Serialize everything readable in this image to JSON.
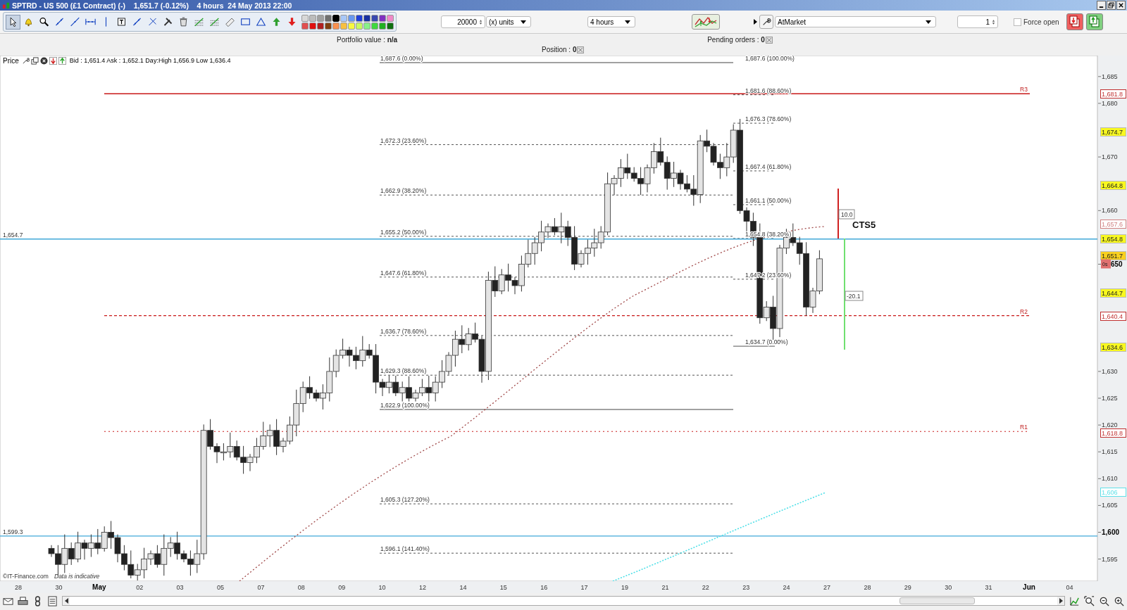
{
  "window": {
    "title": "SPTRD - US 500 (£1 Contract) (-)    1,651.7 (-0.12%)    4 hours  24 May 2013 22:00"
  },
  "toolbar": {
    "tools": [
      {
        "kind": "pointer",
        "selected": true
      },
      {
        "kind": "alert",
        "selected": false
      },
      {
        "kind": "zoom",
        "selected": false
      },
      {
        "kind": "segment",
        "selected": false
      },
      {
        "kind": "ray",
        "selected": false
      },
      {
        "kind": "hline",
        "selected": false
      },
      {
        "kind": "vline",
        "selected": false
      },
      {
        "kind": "text",
        "selected": false
      },
      {
        "kind": "segment",
        "selected": false
      },
      {
        "kind": "cross",
        "selected": false
      },
      {
        "kind": "hammer",
        "selected": false
      },
      {
        "kind": "delete",
        "selected": false
      },
      {
        "kind": "grid",
        "selected": false
      },
      {
        "kind": "grid",
        "selected": false
      },
      {
        "kind": "ruler",
        "selected": false
      },
      {
        "kind": "rectangle",
        "selected": false
      },
      {
        "kind": "triangle",
        "selected": false
      },
      {
        "kind": "up",
        "selected": false
      },
      {
        "kind": "down",
        "selected": false
      }
    ],
    "swatches": [
      {
        "color": "#d8d8d8",
        "selected": false
      },
      {
        "color": "#bcbcbc",
        "selected": false
      },
      {
        "color": "#a0a0a0",
        "selected": false
      },
      {
        "color": "#707070",
        "selected": false
      },
      {
        "color": "#000000",
        "selected": true
      },
      {
        "color": "#a8c8f8",
        "selected": false
      },
      {
        "color": "#6898f0",
        "selected": false
      },
      {
        "color": "#2040d8",
        "selected": false
      },
      {
        "color": "#1830a0",
        "selected": false
      },
      {
        "color": "#3848b0",
        "selected": false
      },
      {
        "color": "#8030c0",
        "selected": false
      },
      {
        "color": "#f088c8",
        "selected": false
      },
      {
        "color": "#e05050",
        "selected": false
      },
      {
        "color": "#e01010",
        "selected": false
      },
      {
        "color": "#b02020",
        "selected": false
      },
      {
        "color": "#804010",
        "selected": false
      },
      {
        "color": "#f89050",
        "selected": false
      },
      {
        "color": "#f8c040",
        "selected": false
      },
      {
        "color": "#f8f840",
        "selected": false
      },
      {
        "color": "#c8f860",
        "selected": false
      },
      {
        "color": "#88f088",
        "selected": false
      },
      {
        "color": "#40d840",
        "selected": false
      },
      {
        "color": "#20b020",
        "selected": false
      },
      {
        "color": "#107010",
        "selected": false
      }
    ],
    "quantity": "20000",
    "units": "(x) units",
    "interval": "4 hours",
    "order_type": "AtMarket",
    "lots": "1",
    "force_open": {
      "label": "Force open",
      "checked": false
    }
  },
  "info": {
    "portfolio": "Portfolio value : **n/a**",
    "position": "Position : **0**",
    "pending": "Pending orders : **0**"
  },
  "legend": {
    "title": "Price",
    "quote": "Bid : 1,651.4 Ask : 1,652.1 Day:High 1,656.9 Low 1,636.4"
  },
  "fib_left": [
    "1,687.6 (0.00%)",
    "1,672.3 (23.60%)",
    "1,662.9 (38.20%)",
    "1,655.2 (50.00%)",
    "1,647.6 (61.80%)",
    "1,636.7 (78.60%)",
    "1,629.3 (88.60%)",
    "1,622.9 (100.00%)",
    "1,605.3 (127.20%)",
    "1,596.1 (141.40%)"
  ],
  "fib_right": [
    "1,687.6 (100.00%)",
    "1,681.6 (88.60%)",
    "1,676.3 (78.60%)",
    "1,667.4 (61.80%)",
    "1,661.1 (50.00%)",
    "1,654.8 (38.20%)",
    "1,647.2 (23.60%)",
    "1,634.7 (0.00%)"
  ],
  "levels": [
    {
      "label": "R3",
      "kind": "solid"
    },
    {
      "label": "R2",
      "kind": "dashed"
    },
    {
      "label": "R1",
      "kind": "dotted"
    }
  ],
  "hlines": [
    "1,654.7",
    "1,599.3"
  ],
  "target": {
    "up": "10.0",
    "down": "-20.1",
    "name": "CTS5"
  },
  "price_ticks": [
    {
      "text": "1,685",
      "bold": false
    },
    {
      "text": "1,680",
      "bold": false
    },
    {
      "text": "1,670",
      "bold": false
    },
    {
      "text": "1,660",
      "bold": false
    },
    {
      "text": "650",
      "bold": true
    },
    {
      "text": "1,630",
      "bold": false
    },
    {
      "text": "1,625",
      "bold": false
    },
    {
      "text": "1,620",
      "bold": false
    },
    {
      "text": "1,615",
      "bold": false
    },
    {
      "text": "1,610",
      "bold": false
    },
    {
      "text": "1,605",
      "bold": false
    },
    {
      "text": "1,600",
      "bold": true
    },
    {
      "text": "1,595",
      "bold": false
    }
  ],
  "price_markers": [
    {
      "text": "1,681.8",
      "kind": "outlined",
      "color": "#c03030"
    },
    {
      "text": "1,674.7",
      "kind": "filled",
      "color": "#f8f820"
    },
    {
      "text": "1,664.8",
      "kind": "filled",
      "color": "#f8f820"
    },
    {
      "text": "1,657.6",
      "kind": "outlined",
      "color": "#d08080"
    },
    {
      "text": "1,654.8",
      "kind": "filled",
      "color": "#f8f820"
    },
    {
      "text": "1,651.7",
      "kind": "filled",
      "color": "#f8d020"
    },
    {
      "text": "1,644.7",
      "kind": "filled",
      "color": "#f8f820"
    },
    {
      "text": "1,640.4",
      "kind": "outlined",
      "color": "#c03030"
    },
    {
      "text": "1,634.6",
      "kind": "filled",
      "color": "#f8f820"
    },
    {
      "text": "1,618.8",
      "kind": "outlined",
      "color": "#c03030"
    },
    {
      "text": "1,606",
      "kind": "outlined",
      "color": "#60e0e8"
    }
  ],
  "countdown": "0s",
  "dates": [
    {
      "text": "28",
      "bold": false
    },
    {
      "text": "30",
      "bold": false
    },
    {
      "text": "May",
      "bold": true
    },
    {
      "text": "02",
      "bold": false
    },
    {
      "text": "03",
      "bold": false
    },
    {
      "text": "05",
      "bold": false
    },
    {
      "text": "07",
      "bold": false
    },
    {
      "text": "08",
      "bold": false
    },
    {
      "text": "09",
      "bold": false
    },
    {
      "text": "10",
      "bold": false
    },
    {
      "text": "12",
      "bold": false
    },
    {
      "text": "14",
      "bold": false
    },
    {
      "text": "15",
      "bold": false
    },
    {
      "text": "16",
      "bold": false
    },
    {
      "text": "17",
      "bold": false
    },
    {
      "text": "19",
      "bold": false
    },
    {
      "text": "21",
      "bold": false
    },
    {
      "text": "22",
      "bold": false
    },
    {
      "text": "23",
      "bold": false
    },
    {
      "text": "24",
      "bold": false
    },
    {
      "text": "27",
      "bold": false
    },
    {
      "text": "28",
      "bold": false
    },
    {
      "text": "29",
      "bold": false
    },
    {
      "text": "30",
      "bold": false
    },
    {
      "text": "31",
      "bold": false
    },
    {
      "text": "Jun",
      "bold": true
    },
    {
      "text": "04",
      "bold": false
    }
  ],
  "credit": "©IT-Finance.com",
  "disclaimer": "Data is indicative"
}
